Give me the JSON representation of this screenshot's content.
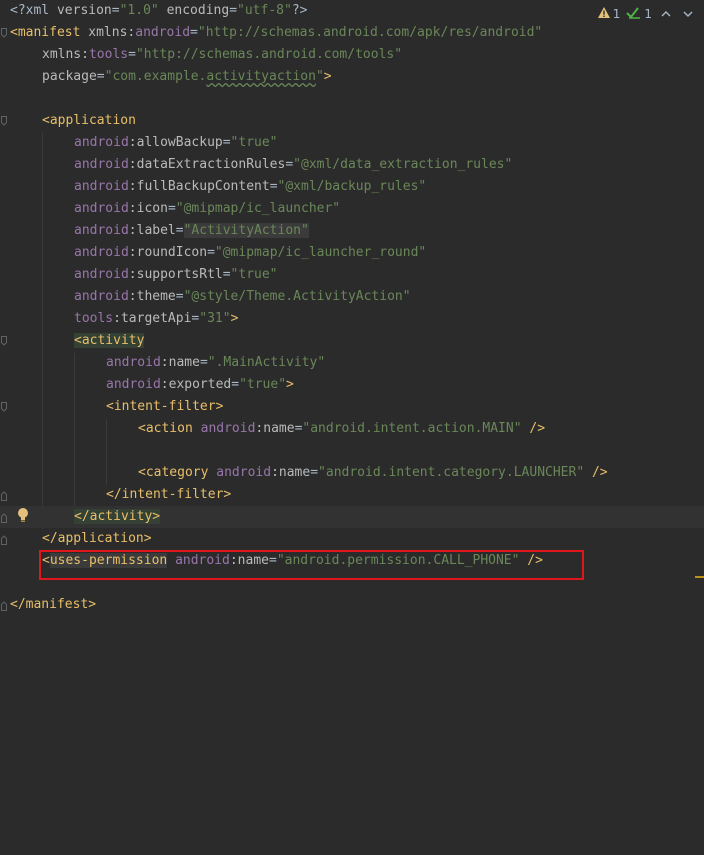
{
  "inspections": {
    "warnings_count": "1",
    "weak_warnings_count": "1"
  },
  "lines": {
    "l1": {
      "p1": "<?",
      "p2": "xml ",
      "p3": "version",
      "p4": "=",
      "p5": "\"1.0\"",
      "p6": " ",
      "p7": "encoding",
      "p8": "=",
      "p9": "\"utf-8\"",
      "p10": "?>"
    },
    "l2": {
      "p1": "<",
      "p2": "manifest ",
      "p3": "xmlns:",
      "p4": "android",
      "p5": "=",
      "p6": "\"http://schemas.android.com/apk/res/android\""
    },
    "l3": {
      "p1": "xmlns:",
      "p2": "tools",
      "p3": "=",
      "p4": "\"http://schemas.android.com/tools\""
    },
    "l4": {
      "p1": "package",
      "p2": "=",
      "p3": "\"com.example.",
      "p4": "activityaction",
      "p5": "\"",
      "p6": ">"
    },
    "l6": {
      "p1": "<application"
    },
    "l7": {
      "p1": "android",
      "p2": ":allowBackup",
      "p3": "=",
      "p4": "\"true\""
    },
    "l8": {
      "p1": "android",
      "p2": ":dataExtractionRules",
      "p3": "=",
      "p4": "\"@xml/data_extraction_rules\""
    },
    "l9": {
      "p1": "android",
      "p2": ":fullBackupContent",
      "p3": "=",
      "p4": "\"@xml/backup_rules\""
    },
    "l10": {
      "p1": "android",
      "p2": ":icon",
      "p3": "=",
      "p4": "\"@mipmap/ic_launcher\""
    },
    "l11": {
      "p1": "android",
      "p2": ":label",
      "p3": "=",
      "p4": "\"ActivityAction\""
    },
    "l12": {
      "p1": "android",
      "p2": ":roundIcon",
      "p3": "=",
      "p4": "\"@mipmap/ic_launcher_round\""
    },
    "l13": {
      "p1": "android",
      "p2": ":supportsRtl",
      "p3": "=",
      "p4": "\"true\""
    },
    "l14": {
      "p1": "android",
      "p2": ":theme",
      "p3": "=",
      "p4": "\"@style/Theme.ActivityAction\""
    },
    "l15": {
      "p1": "tools",
      "p2": ":targetApi",
      "p3": "=",
      "p4": "\"31\"",
      "p5": ">"
    },
    "l16": {
      "p1": "<activity"
    },
    "l17": {
      "p1": "android",
      "p2": ":name",
      "p3": "=",
      "p4": "\".MainActivity\""
    },
    "l18": {
      "p1": "android",
      "p2": ":exported",
      "p3": "=",
      "p4": "\"true\"",
      "p5": ">"
    },
    "l19": {
      "p1": "<intent-filter>"
    },
    "l20": {
      "p1": "<action ",
      "p2": "android",
      "p3": ":name",
      "p4": "=",
      "p5": "\"android.intent.action.MAIN\"",
      "p6": " />"
    },
    "l22": {
      "p1": "<category ",
      "p2": "android",
      "p3": ":name",
      "p4": "=",
      "p5": "\"android.intent.category.LAUNCHER\"",
      "p6": " />"
    },
    "l23": {
      "p1": "</intent-filter>"
    },
    "l24": {
      "p1": "</activity>"
    },
    "l25": {
      "p1": "</application>"
    },
    "l26": {
      "p1": "<",
      "p2": "uses-permission",
      "p3": " ",
      "p4": "android",
      "p5": ":name",
      "p6": "=",
      "p7": "\"android.permission.CALL_PHONE\"",
      "p8": " />"
    },
    "l28": {
      "p1": "</manifest>"
    }
  },
  "colors": {
    "background": "#2b2b2b",
    "tag": "#e8bf6a",
    "namespace": "#9876aa",
    "attribute": "#bababa",
    "value": "#6a8759",
    "highlight_box": "#e0161a",
    "warning": "#e5c07b",
    "weak_warning": "#4fb346"
  },
  "icons": {
    "warning": "warning-triangle-icon",
    "weak_warning": "check-double-icon",
    "prev": "chevron-up-icon",
    "next": "chevron-down-icon",
    "intention": "lightbulb-icon",
    "fold": "fold-arrow-icon"
  }
}
